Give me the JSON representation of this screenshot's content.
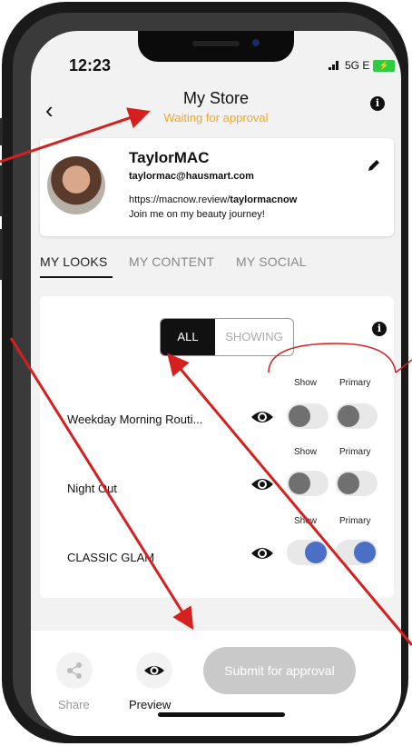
{
  "status_bar": {
    "time": "12:23",
    "network": "5G E",
    "battery_icon": "battery-charging-icon"
  },
  "header": {
    "back_icon": "back-chevron-icon",
    "title": "My Store",
    "subtitle": "Waiting for approval",
    "info_icon": "info-icon"
  },
  "profile": {
    "name": "TaylorMAC",
    "email": "taylormac@hausmart.com",
    "url_prefix": "https://macnow.review/",
    "url_handle": "taylormacnow",
    "bio": "Join me on my beauty journey!",
    "edit_icon": "pencil-icon"
  },
  "tabs": [
    {
      "label": "MY LOOKS",
      "active": true
    },
    {
      "label": "MY CONTENT",
      "active": false
    },
    {
      "label": "MY SOCIAL",
      "active": false
    }
  ],
  "filter": {
    "all_label": "ALL",
    "showing_label": "SHOWING",
    "selected": "ALL"
  },
  "columns": {
    "show": "Show",
    "primary": "Primary"
  },
  "looks": [
    {
      "name": "Weekday Morning Routi...",
      "show": false,
      "primary": false
    },
    {
      "name": "Night Out",
      "show": false,
      "primary": false
    },
    {
      "name": "CLASSIC GLAM",
      "show": true,
      "primary": true
    }
  ],
  "footer": {
    "share_label": "Share",
    "preview_label": "Preview",
    "submit_label": "Submit for approval"
  },
  "colors": {
    "accent_warning": "#f5a623",
    "toggle_on": "#4a6fc4",
    "annotation": "#d61f1f"
  }
}
